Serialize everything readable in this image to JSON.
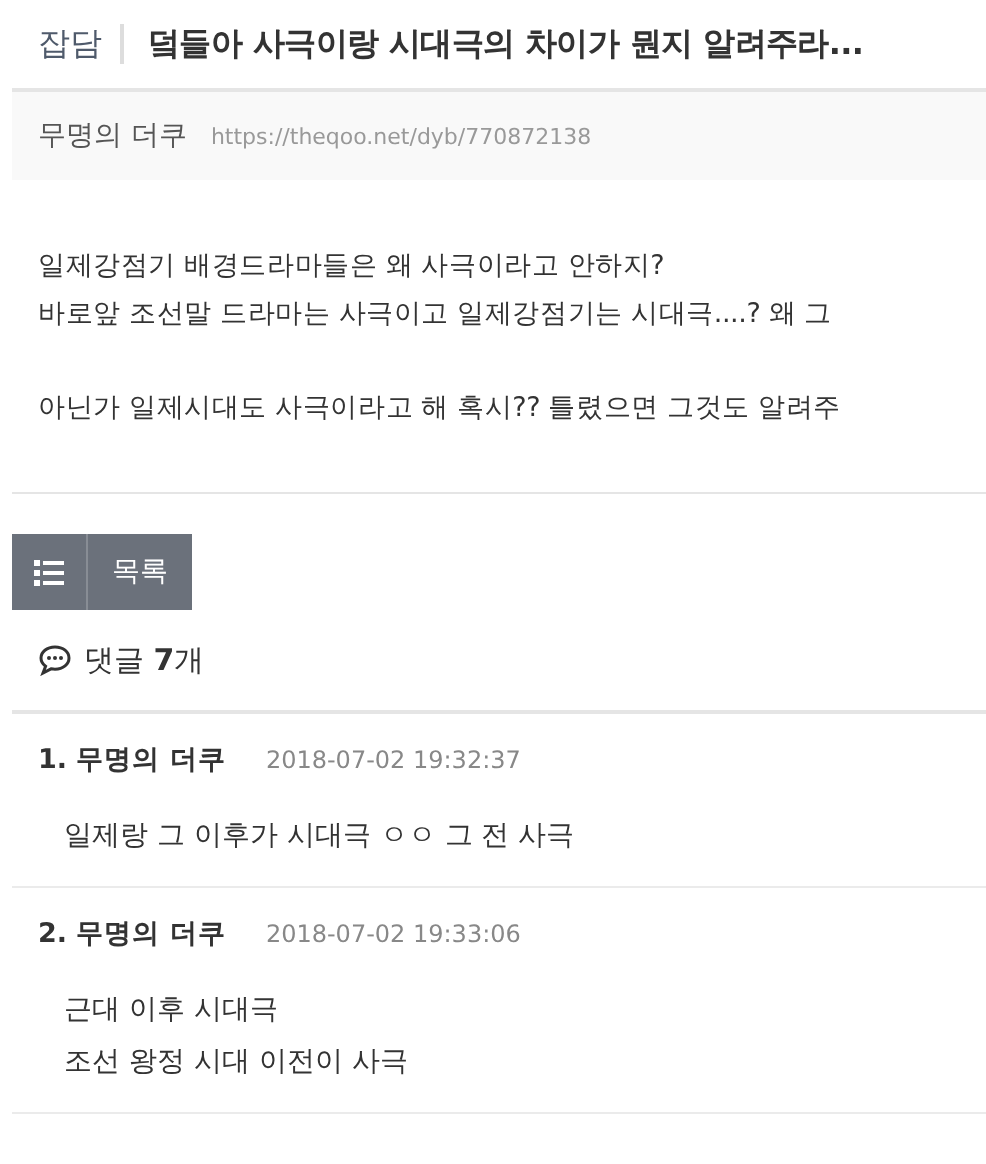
{
  "header": {
    "category": "잡담",
    "title": "덬들아 사극이랑 시대극의 차이가 뭔지 알려주라..."
  },
  "info": {
    "author": "무명의 더쿠",
    "url": "https://theqoo.net/dyb/770872138"
  },
  "body": {
    "paragraphs": [
      [
        "일제강점기 배경드라마들은 왜 사극이라고 안하지?",
        "바로앞 조선말 드라마는 사극이고 일제강점기는 시대극....? 왜 그"
      ],
      [
        "아닌가 일제시대도 사극이라고 해 혹시?? 틀렸으면 그것도 알려주"
      ]
    ]
  },
  "list_button": {
    "label": "목록"
  },
  "comments": {
    "heading": "댓글 **7**개",
    "items": [
      {
        "number": "1.",
        "author": "무명의 더쿠",
        "time": "2018-07-02 19:32:37",
        "lines": [
          "일제랑 그 이후가 시대극 ㅇㅇ 그 전 사극"
        ]
      },
      {
        "number": "2.",
        "author": "무명의 더쿠",
        "time": "2018-07-02 19:33:06",
        "lines": [
          "근대 이후 시대극",
          "조선 왕정 시대 이전이 사극"
        ]
      }
    ]
  }
}
